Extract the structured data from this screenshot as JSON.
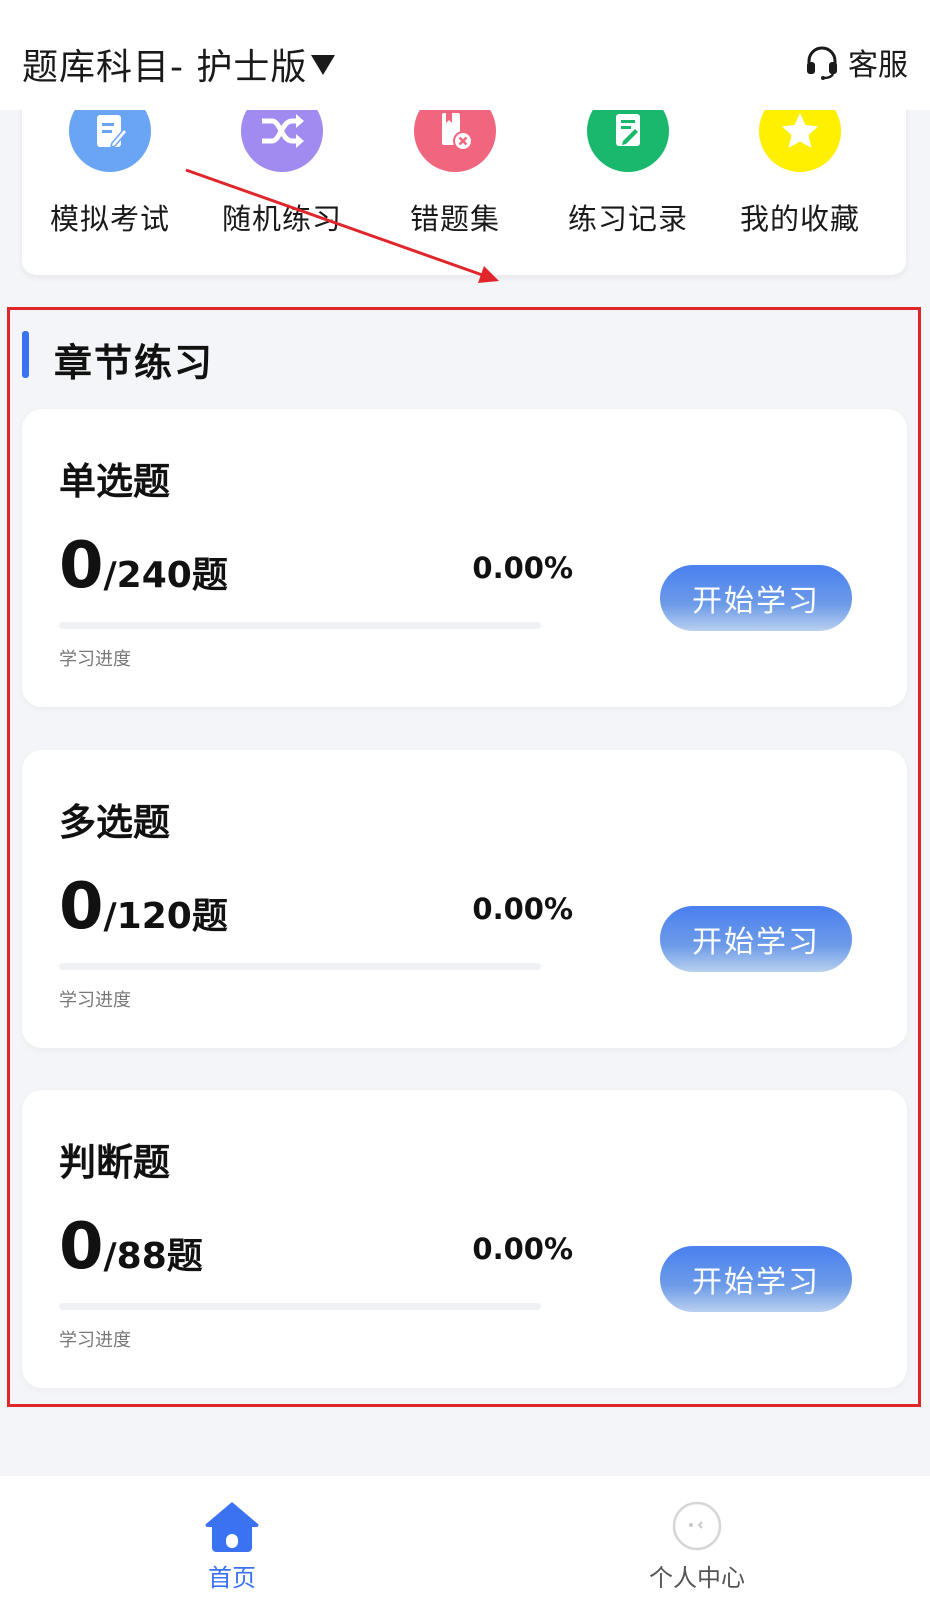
{
  "header": {
    "subject_title": "题库科目- 护士版",
    "service_label": "客服"
  },
  "quick_actions": [
    {
      "label": "模拟考试",
      "icon": "exam-icon",
      "color": "#6aa5f5"
    },
    {
      "label": "随机练习",
      "icon": "shuffle-icon",
      "color": "#a18af0"
    },
    {
      "label": "错题集",
      "icon": "wrong-book-icon",
      "color": "#f0667e"
    },
    {
      "label": "练习记录",
      "icon": "record-icon",
      "color": "#19b86c"
    },
    {
      "label": "我的收藏",
      "icon": "star-icon",
      "color": "#fff000"
    }
  ],
  "section": {
    "title": "章节练习"
  },
  "question_types": [
    {
      "title": "单选题",
      "done": "0",
      "total": "/240题",
      "percent": "0.00%",
      "progress": 0,
      "progress_label": "学习进度",
      "button": "开始学习"
    },
    {
      "title": "多选题",
      "done": "0",
      "total": "/120题",
      "percent": "0.00%",
      "progress": 0,
      "progress_label": "学习进度",
      "button": "开始学习"
    },
    {
      "title": "判断题",
      "done": "0",
      "total": "/88题",
      "percent": "0.00%",
      "progress": 0,
      "progress_label": "学习进度",
      "button": "开始学习"
    }
  ],
  "bottom_nav": {
    "home": "首页",
    "profile": "个人中心"
  },
  "colors": {
    "accent": "#3b72f2",
    "annotation": "#e0262b"
  }
}
